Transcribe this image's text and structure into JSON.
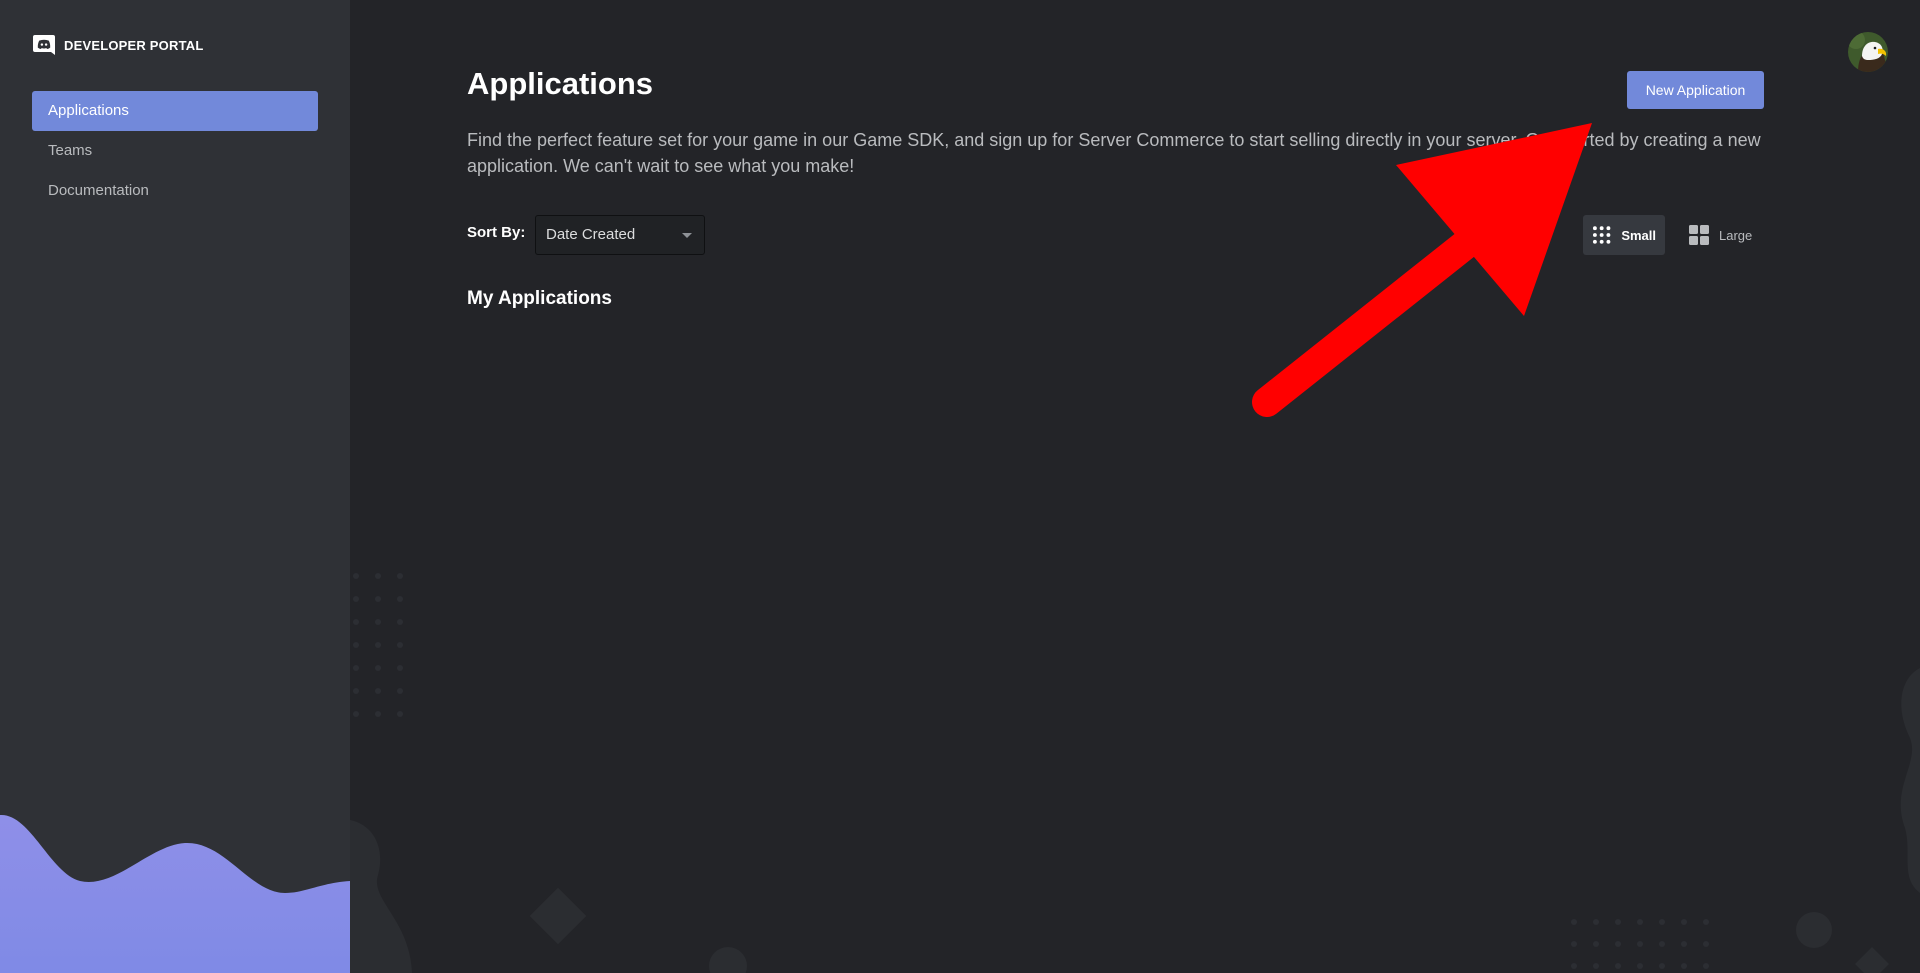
{
  "brand": {
    "title": "DEVELOPER PORTAL",
    "logo_icon": "discord-logo-icon"
  },
  "sidebar": {
    "items": [
      {
        "label": "Applications",
        "active": true
      },
      {
        "label": "Teams",
        "active": false
      },
      {
        "label": "Documentation",
        "active": false
      }
    ]
  },
  "header": {
    "title": "Applications",
    "new_application_label": "New Application",
    "avatar_icon": "eagle-avatar"
  },
  "main": {
    "description": "Find the perfect feature set for your game in our Game SDK, and sign up for Server Commerce to start selling directly in your server. Get started by creating a new application. We can't wait to see what you make!",
    "sort": {
      "label": "Sort By:",
      "selected": "Date Created"
    },
    "view": {
      "small_label": "Small",
      "large_label": "Large",
      "selected": "Small"
    },
    "section_title": "My Applications"
  },
  "colors": {
    "accent": "#7289da",
    "sidebar_bg": "#2f3136",
    "main_bg": "#232428",
    "annotation": "#ff0000"
  }
}
